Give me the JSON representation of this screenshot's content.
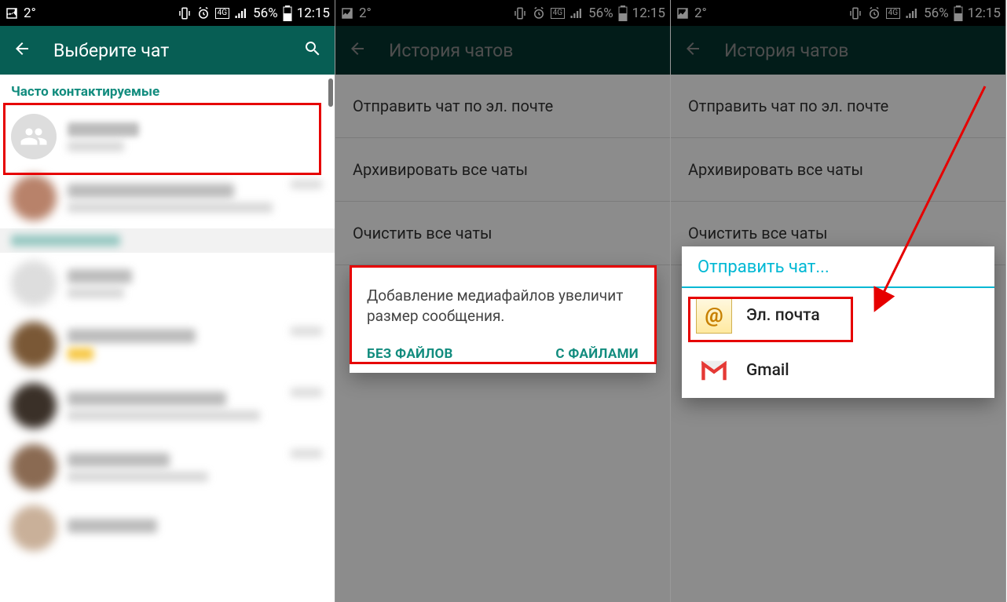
{
  "status": {
    "temp": "2°",
    "network": "4G",
    "battery": "56%",
    "time": "12:15"
  },
  "screen1": {
    "title": "Выберите чат",
    "section_header": "Часто контактируемые"
  },
  "screen2": {
    "title": "История чатов",
    "items": [
      "Отправить чат по эл. почте",
      "Архивировать все чаты",
      "Очистить все чаты"
    ],
    "dialog_msg": "Добавление медиафайлов увеличит размер сообщения.",
    "dialog_btn_nofiles": "БЕЗ ФАЙЛОВ",
    "dialog_btn_withfiles": "С ФАЙЛАМИ"
  },
  "screen3": {
    "title": "История чатов",
    "items": [
      "Отправить чат по эл. почте",
      "Архивировать все чаты",
      "Очистить все чаты"
    ],
    "chooser_title": "Отправить чат...",
    "chooser_email": "Эл. почта",
    "chooser_gmail": "Gmail"
  }
}
